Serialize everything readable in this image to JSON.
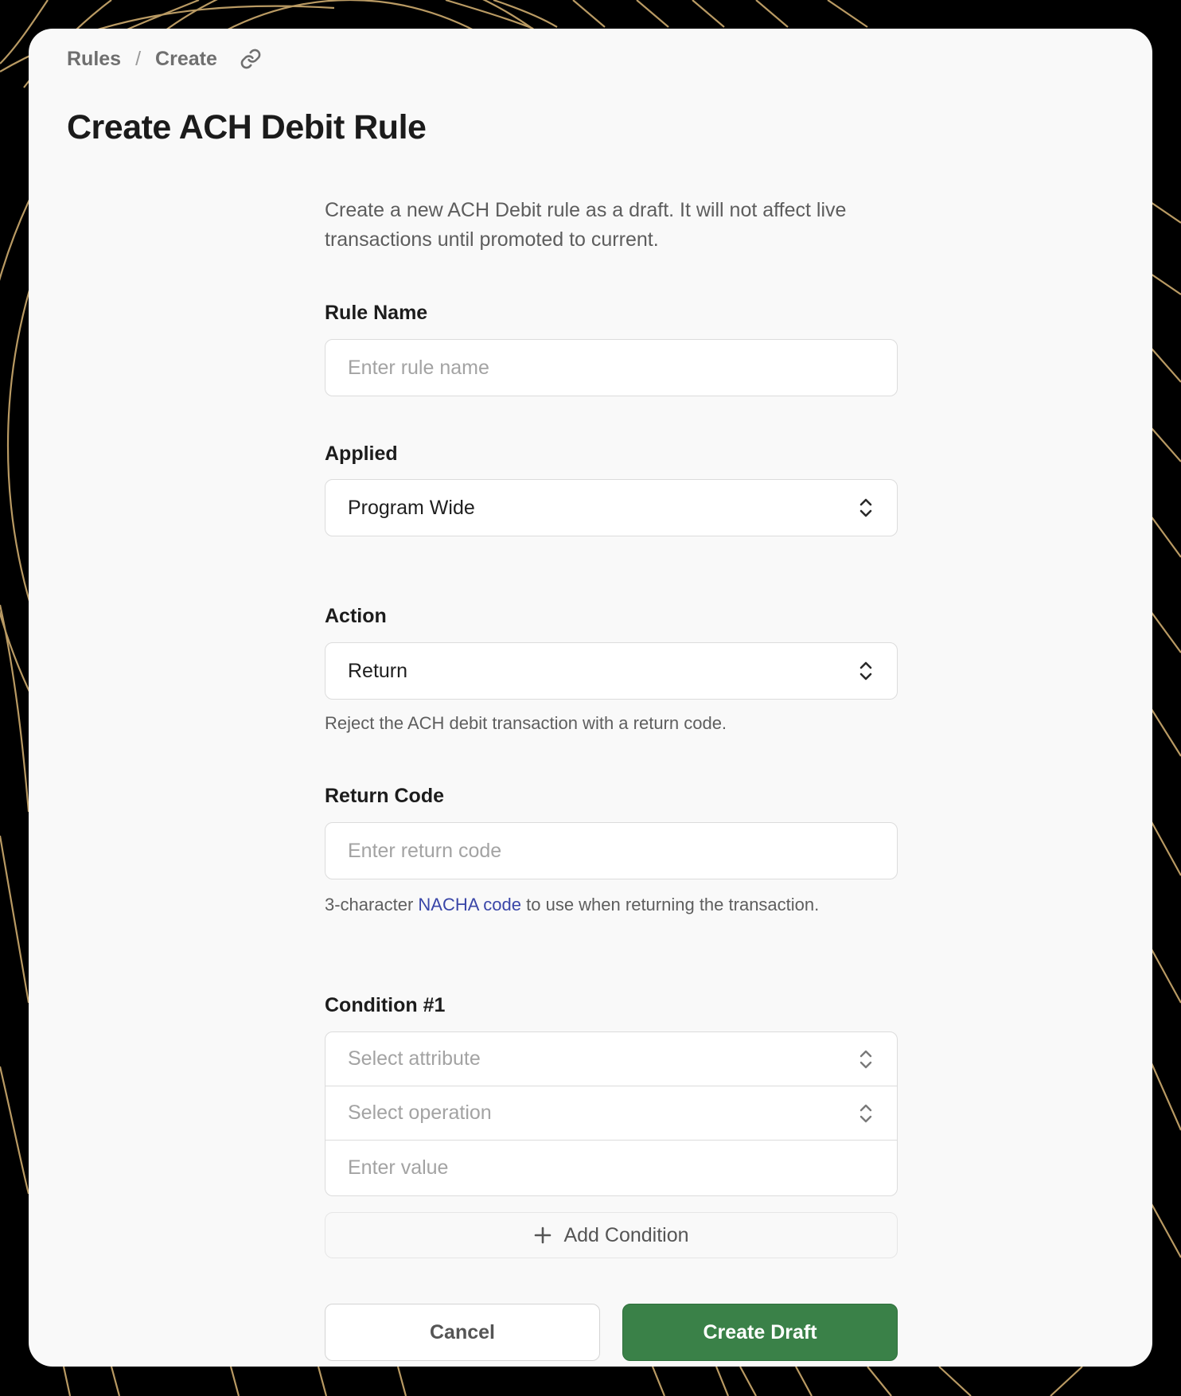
{
  "breadcrumb": {
    "root": "Rules",
    "separator": "/",
    "current": "Create",
    "link_icon": "link-icon"
  },
  "page": {
    "title": "Create ACH Debit Rule",
    "intro": "Create a new ACH Debit rule as a draft. It will not affect live transactions until promoted to current."
  },
  "form": {
    "rule_name": {
      "label": "Rule Name",
      "placeholder": "Enter rule name",
      "value": ""
    },
    "applied": {
      "label": "Applied",
      "value": "Program Wide",
      "icon": "chevron-up-down-icon"
    },
    "action": {
      "label": "Action",
      "value": "Return",
      "help": "Reject the ACH debit transaction with a return code.",
      "icon": "chevron-up-down-icon"
    },
    "return_code": {
      "label": "Return Code",
      "placeholder": "Enter return code",
      "value": "",
      "help_prefix": "3-character ",
      "help_link": "NACHA code",
      "help_suffix": " to use when returning the transaction."
    },
    "condition": {
      "label": "Condition #1",
      "attribute_placeholder": "Select attribute",
      "operation_placeholder": "Select operation",
      "value_placeholder": "Enter value"
    },
    "add_condition": "Add Condition",
    "cancel": "Cancel",
    "submit": "Create Draft"
  },
  "colors": {
    "background": "#000000",
    "decor_lines": "#b99a63",
    "card": "#f9f9f9",
    "primary": "#3a8148",
    "link": "#3a46a8"
  }
}
